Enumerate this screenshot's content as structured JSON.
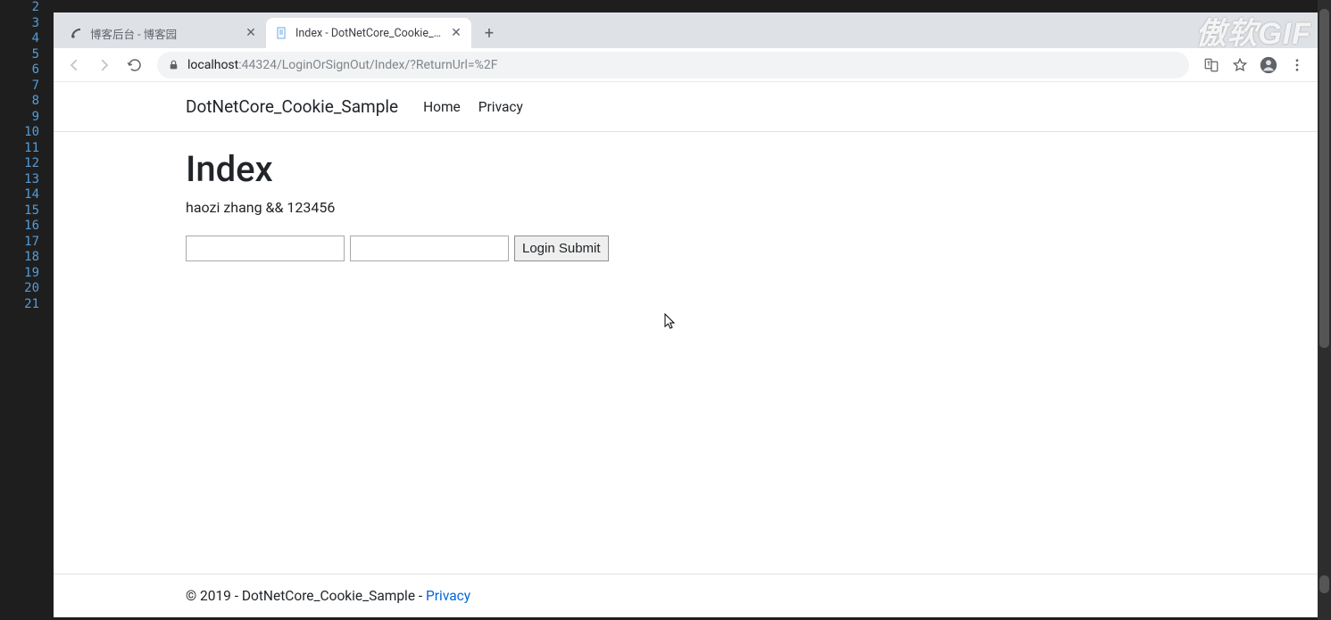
{
  "editor": {
    "line_numbers": [
      "2",
      "3",
      "4",
      "5",
      "6",
      "7",
      "8",
      "9",
      "10",
      "11",
      "12",
      "13",
      "14",
      "15",
      "16",
      "17",
      "18",
      "19",
      "20",
      "21"
    ]
  },
  "watermark": "傲软GIF",
  "browser": {
    "tabs": [
      {
        "title": "博客后台 - 博客园",
        "active": false
      },
      {
        "title": "Index - DotNetCore_Cookie_S...",
        "active": true
      }
    ],
    "new_tab": "+",
    "address": {
      "host": "localhost",
      "rest": ":44324/LoginOrSignOut/Index/?ReturnUrl=%2F"
    }
  },
  "page": {
    "brand": "DotNetCore_Cookie_Sample",
    "nav": {
      "home": "Home",
      "privacy": "Privacy"
    },
    "heading": "Index",
    "subtext": "haozi zhang && 123456",
    "username_value": "",
    "password_value": "",
    "submit_label": "Login Submit",
    "footer_text": "© 2019 - DotNetCore_Cookie_Sample - ",
    "footer_link": "Privacy"
  }
}
